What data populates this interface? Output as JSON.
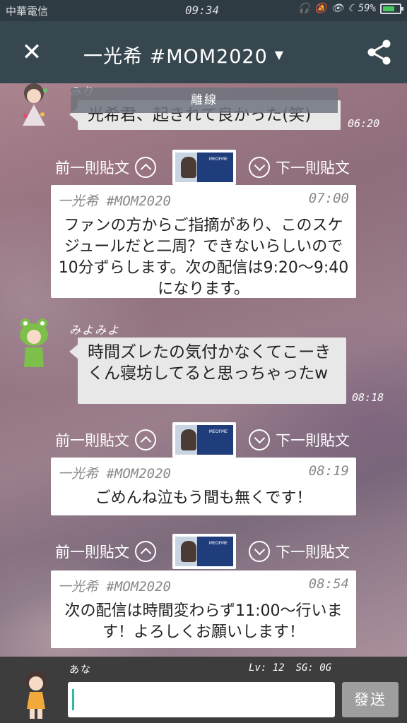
{
  "status": {
    "carrier": "中華電信",
    "time": "09:34",
    "battery_pct": "59%"
  },
  "header": {
    "title": "一光希 #MOM2020",
    "close_icon": "close-icon",
    "share_icon": "share-icon"
  },
  "chat": {
    "offline_banner": "離線",
    "messages": [
      {
        "user": "みり",
        "text": "光希君、起きれて良かった(笑)",
        "time": "06:20"
      },
      {
        "user": "みよみよ",
        "text": "時間ズレたの気付かなくてこーきくん寝坊してると思っちゃったw",
        "time": "08:18"
      }
    ],
    "nav": {
      "prev_label": "前一則貼文",
      "next_label": "下一則貼文"
    },
    "posts": [
      {
        "author": "一光希 #MOM2020",
        "time": "07:00",
        "text": "ファンの方からご指摘があり、このスケジュールだと二周？できないらしいので10分ずらします。次の配信は9:20〜9:40になります。"
      },
      {
        "author": "一光希 #MOM2020",
        "time": "08:19",
        "text": "ごめんね泣もう間も無くです！"
      },
      {
        "author": "一光希 #MOM2020",
        "time": "08:54",
        "text": "次の配信は時間変わらず11:00〜行います！よろしくお願いします！"
      }
    ]
  },
  "input": {
    "my_name": "あな",
    "lv_label": "Lv: 12",
    "sg_label": "SG: 0G",
    "value": "",
    "send_label": "發送"
  }
}
